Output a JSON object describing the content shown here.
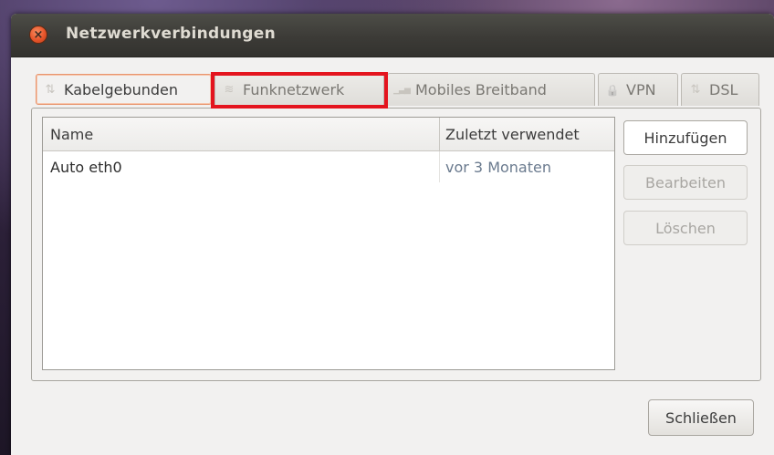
{
  "window": {
    "title": "Netzwerkverbindungen",
    "close_icon": "×"
  },
  "tabs": [
    {
      "label": "Kabelgebunden",
      "icon": "wired-icon",
      "glyph": "⇅",
      "active": true
    },
    {
      "label": "Funknetzwerk",
      "icon": "wireless-icon",
      "glyph": "≋",
      "active": false,
      "highlighted": true
    },
    {
      "label": "Mobiles Breitband",
      "icon": "signal-bars-icon",
      "glyph": "▁▃▅",
      "active": false
    },
    {
      "label": "VPN",
      "icon": "lock-icon",
      "glyph": "🔒",
      "active": false
    },
    {
      "label": "DSL",
      "icon": "dsl-icon",
      "glyph": "⇅",
      "active": false
    }
  ],
  "connections": {
    "columns": [
      "Name",
      "Zuletzt verwendet"
    ],
    "rows": [
      {
        "name": "Auto eth0",
        "last_used": "vor 3 Monaten"
      }
    ]
  },
  "buttons": {
    "add": "Hinzufügen",
    "edit": "Bearbeiten",
    "delete": "Löschen",
    "close": "Schließen"
  },
  "colors": {
    "highlight": "#e4141e",
    "active_tab_border": "#e8956e",
    "close_button": "#e6542a",
    "last_used_text": "#6a7a8e"
  }
}
